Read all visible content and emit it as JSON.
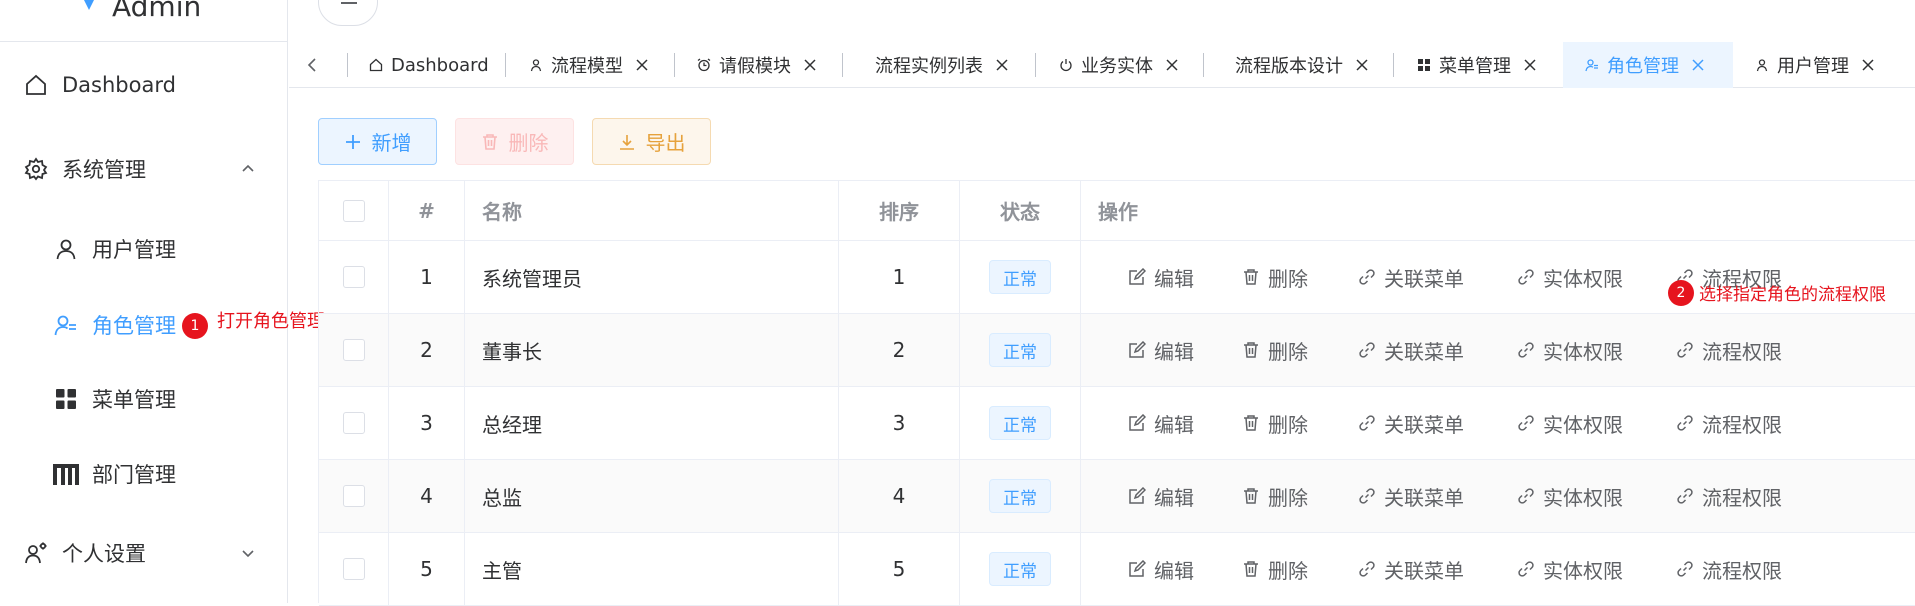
{
  "app": {
    "title": "Admin"
  },
  "sidebar": {
    "items": [
      {
        "label": "Dashboard",
        "icon": "home-icon"
      },
      {
        "label": "系统管理",
        "icon": "gear-icon",
        "expanded": true
      },
      {
        "label": "用户管理",
        "icon": "user-icon"
      },
      {
        "label": "角色管理",
        "icon": "user-role-icon",
        "active": true
      },
      {
        "label": "菜单管理",
        "icon": "grid-icon"
      },
      {
        "label": "部门管理",
        "icon": "department-icon"
      },
      {
        "label": "个人设置",
        "icon": "user-settings-icon",
        "expanded": false
      }
    ]
  },
  "annotations": {
    "a1": {
      "number": "1",
      "text": "打开角色管理"
    },
    "a2": {
      "number": "2",
      "text": "选择指定角色的流程权限"
    }
  },
  "tabs": [
    {
      "label": "Dashboard",
      "icon": "home-icon",
      "closable": false
    },
    {
      "label": "流程模型",
      "icon": "model-icon",
      "closable": true
    },
    {
      "label": "请假模块",
      "icon": "alarm-icon",
      "closable": true
    },
    {
      "label": "流程实例列表",
      "icon": "",
      "closable": true
    },
    {
      "label": "业务实体",
      "icon": "power-icon",
      "closable": true
    },
    {
      "label": "流程版本设计",
      "icon": "",
      "closable": true
    },
    {
      "label": "菜单管理",
      "icon": "grid-icon",
      "closable": true
    },
    {
      "label": "角色管理",
      "icon": "user-role-icon",
      "closable": true,
      "active": true
    },
    {
      "label": "用户管理",
      "icon": "user-icon",
      "closable": true
    }
  ],
  "toolbar": {
    "add": "新增",
    "delete": "删除",
    "export": "导出"
  },
  "table": {
    "headers": {
      "index": "#",
      "name": "名称",
      "sort": "排序",
      "status": "状态",
      "ops": "操作"
    },
    "ops": {
      "edit": "编辑",
      "delete": "删除",
      "link_menu": "关联菜单",
      "entity_perm": "实体权限",
      "flow_perm": "流程权限"
    },
    "rows": [
      {
        "index": "1",
        "name": "系统管理员",
        "sort": "1",
        "status": "正常"
      },
      {
        "index": "2",
        "name": "董事长",
        "sort": "2",
        "status": "正常"
      },
      {
        "index": "3",
        "name": "总经理",
        "sort": "3",
        "status": "正常"
      },
      {
        "index": "4",
        "name": "总监",
        "sort": "4",
        "status": "正常"
      },
      {
        "index": "5",
        "name": "主管",
        "sort": "5",
        "status": "正常"
      }
    ]
  },
  "colors": {
    "primary": "#409eff",
    "danger": "#f56c6c",
    "warning": "#e6a23c",
    "annotation": "#e6141e"
  }
}
